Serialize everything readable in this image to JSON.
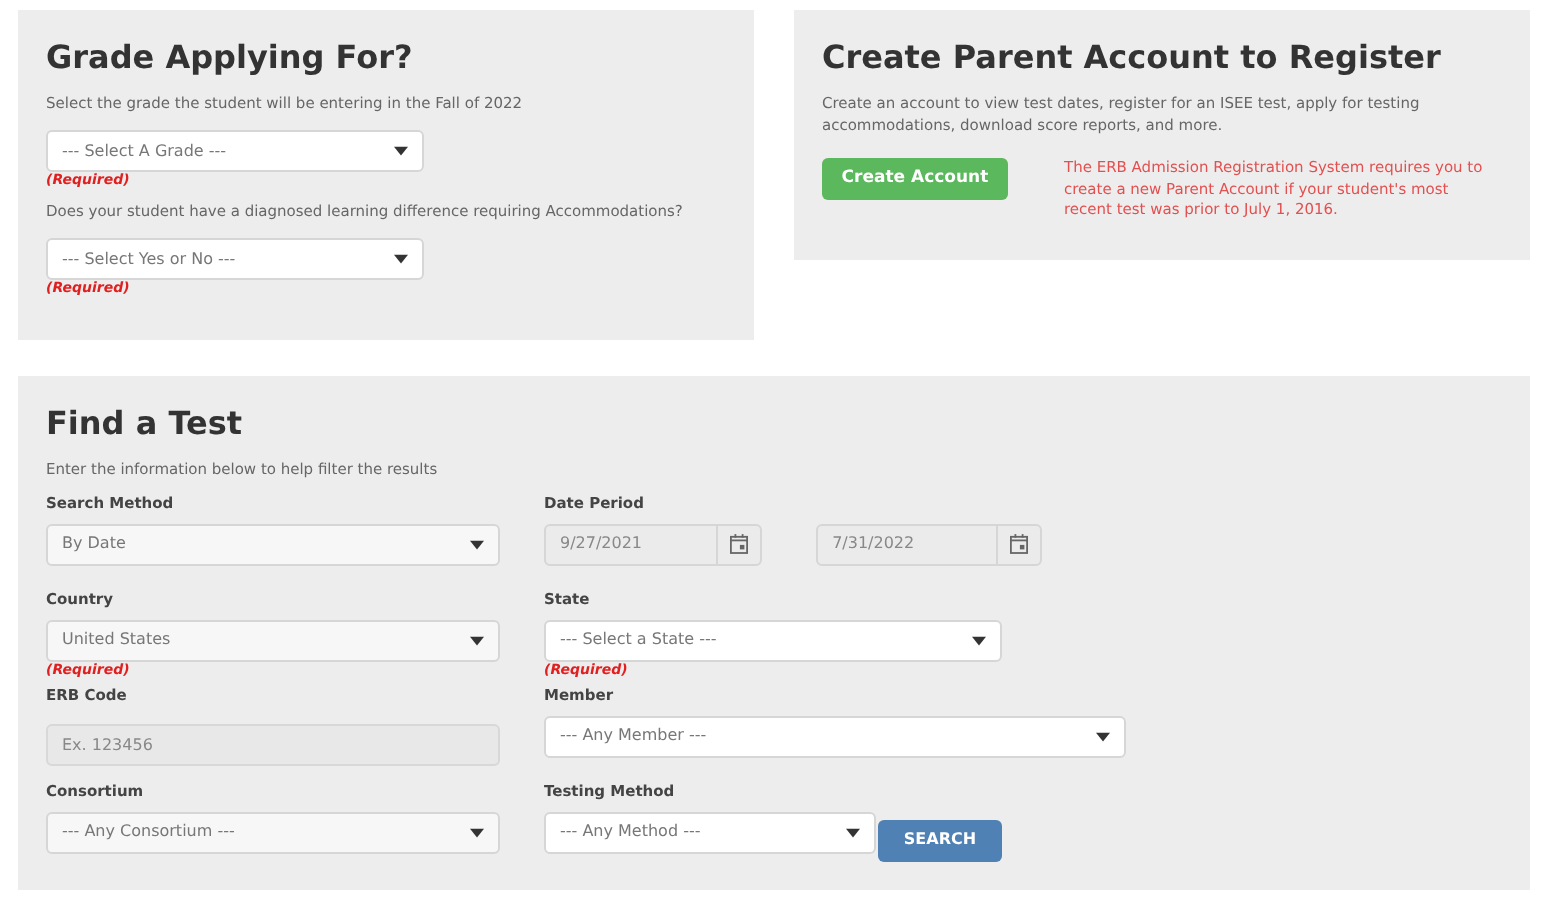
{
  "grade_panel": {
    "title": "Grade Applying For?",
    "intro": "Select the grade the student will be entering in the Fall of 2022",
    "questions": [
      {
        "value": "--- Select A Grade ---",
        "required": "(Required)"
      },
      {
        "prompt": "Does your student have a diagnosed learning difference requiring Accommodations?",
        "value": "--- Select Yes or No ---",
        "required": "(Required)"
      }
    ]
  },
  "account_panel": {
    "title": "Create Parent Account to Register",
    "intro": "Create an account to view test dates, register for an ISEE test, apply for testing accommodations, download score reports, and more.",
    "button": "Create Account",
    "notice": "The ERB Admission Registration System requires you to create a new Parent Account if your student's most recent test was prior to July 1, 2016."
  },
  "find_test": {
    "title": "Find a Test",
    "intro": "Enter the information below to help filter the results",
    "rows": [
      [
        {
          "kind": "select",
          "label": "Search Method",
          "value": "By Date"
        },
        {
          "kind": "date_range",
          "label": "Date Period",
          "values": [
            "9/27/2021",
            "7/31/2022"
          ]
        }
      ],
      [
        {
          "kind": "select",
          "label": "Country",
          "value": "United States",
          "required": "(Required)"
        },
        {
          "kind": "select",
          "label": "State",
          "value": "--- Select a State ---",
          "required": "(Required)"
        }
      ],
      [
        {
          "kind": "text",
          "label": "ERB Code",
          "placeholder": "Ex. 123456"
        },
        {
          "kind": "select",
          "label": "Member",
          "value": "--- Any Member ---"
        }
      ],
      [
        {
          "kind": "select",
          "label": "Consortium",
          "value": "--- Any Consortium ---"
        },
        {
          "kind": "select",
          "label": "Testing Method",
          "value": "--- Any Method ---"
        },
        {
          "kind": "button",
          "label": "SEARCH"
        }
      ]
    ]
  }
}
